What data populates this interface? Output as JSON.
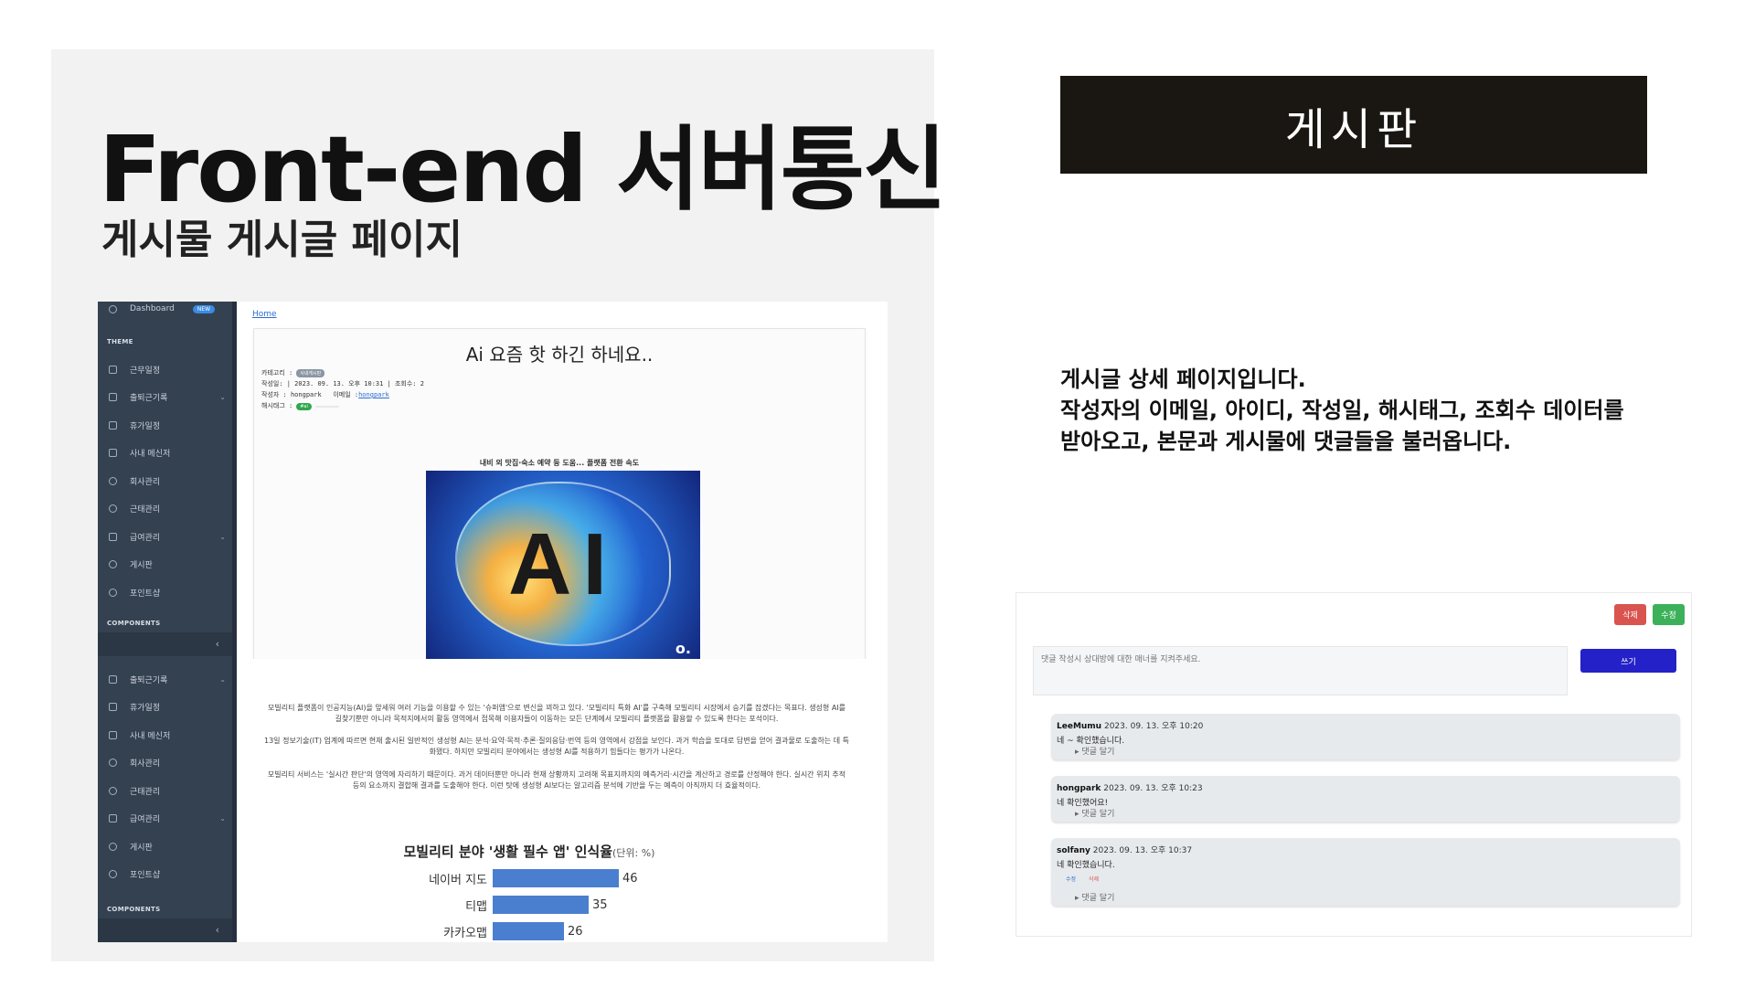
{
  "slide": {
    "title": "Front-end 서버통신",
    "subtitle": "게시물 게시글 페이지",
    "header_box": "게시판",
    "description": [
      "게시글 상세 페이지입니다.",
      "작성자의 이메일, 아이디, 작성일, 해시태그, 조회수 데이터를",
      "받아오고, 본문과 게시물에 댓글들을 불러옵니다."
    ]
  },
  "sidebar": {
    "dashboard": "Dashboard",
    "new_badge": "NEW",
    "theme_section": "THEME",
    "components_section": "COMPONENTS",
    "collapse_glyph": "‹",
    "items_top": [
      {
        "label": "근무일정",
        "icon": "calendar-icon",
        "chevron": false
      },
      {
        "label": "출퇴근기록",
        "icon": "clipboard-icon",
        "chevron": true
      },
      {
        "label": "휴가일정",
        "icon": "columns-icon",
        "chevron": false
      },
      {
        "label": "사내 메신저",
        "icon": "message-icon",
        "chevron": false
      },
      {
        "label": "회사관리",
        "icon": "circle-gear-icon",
        "chevron": false
      },
      {
        "label": "근태관리",
        "icon": "circle-gear-icon",
        "chevron": false
      },
      {
        "label": "급여관리",
        "icon": "money-icon",
        "chevron": true
      },
      {
        "label": "게시판",
        "icon": "circle-gear-icon",
        "chevron": false
      },
      {
        "label": "포인트샵",
        "icon": "circle-gear-icon",
        "chevron": false
      }
    ],
    "items_bottom": [
      {
        "label": "출퇴근기록",
        "icon": "clipboard-icon",
        "chevron": true
      },
      {
        "label": "휴가일정",
        "icon": "columns-icon",
        "chevron": false
      },
      {
        "label": "사내 메신저",
        "icon": "message-icon",
        "chevron": false
      },
      {
        "label": "회사관리",
        "icon": "circle-gear-icon",
        "chevron": false
      },
      {
        "label": "근태관리",
        "icon": "circle-gear-icon",
        "chevron": false
      },
      {
        "label": "급여관리",
        "icon": "money-icon",
        "chevron": true
      },
      {
        "label": "게시판",
        "icon": "circle-gear-icon",
        "chevron": false
      },
      {
        "label": "포인트샵",
        "icon": "circle-gear-icon",
        "chevron": false
      }
    ]
  },
  "post": {
    "breadcrumb": "Home",
    "title": "Ai 요즘 핫 하긴 하네요..",
    "category_label": "카테고리 :",
    "category_value": "사내게시판",
    "date_line": "작성일: | 2023. 09. 13. 오후 10:31 | 조회수: 2",
    "author_label": "작성자 : hongpark",
    "email_label": "이메일 :",
    "email_value": "hongpark",
    "hashtag_label": "해시태그 :",
    "hashtag_value": "#ai",
    "article_caption": "내비 외 맛집·숙소 예약 등 도움... 플랫폼 전환 속도",
    "image_text": "AI",
    "image_logo": "o.",
    "paragraphs": [
      "모빌리티 플랫폼이 인공지능(AI)을 앞세워 여러 기능을 이용할 수 있는 '슈퍼앱'으로 변신을 꾀하고 있다. '모빌리티 특화 AI'를 구축해 모빌리티 시장에서 승기를 잡겠다는 목표다. 생성형 AI를 길찾기뿐만 아니라 목적지에서의 활동 영역에서 접목해 이용자들이 이동하는 모든 단계에서 모빌리티 플랫폼을 활용할 수 있도록 한다는 포석이다.",
      "13일 정보기술(IT) 업계에 따르면 현재 출시된 일반적인 생성형 AI는 분석·요약·목적·추론·질의응답·번역 등의 영역에서 강점을 보인다. 과거 학습을 토대로 답변을 얻어 결과물로 도출하는 데 특화됐다. 하지만 모빌리티 분야에서는 생성형 AI를 적용하기 힘들다는 평가가 나온다.",
      "모빌리티 서비스는 '실시간 판단'의 영역에 자리하기 때문이다. 과거 데이터뿐만 아니라 현재 상황까지 고려해 목표지까지의 예측거리·시간을 계산하고 경로를 산정해야 한다. 실시간 위치 추적 등의 요소까지 결합해 결과를 도출해야 한다. 이런 탓에 생성형 AI보다는 알고리즘 분석에 기반을 두는 예측이 아직까지 더 효율적이다."
    ]
  },
  "chart_data": {
    "type": "bar",
    "title": "모빌리티 분야 '생활 필수 앱' 인식율",
    "unit_note": "(단위: %)",
    "categories": [
      "네이버 지도",
      "티맵",
      "카카오맵"
    ],
    "values": [
      46,
      35,
      26
    ],
    "value_labels": [
      "46",
      "35",
      "26"
    ],
    "xlim": [
      0,
      50
    ]
  },
  "comments": {
    "delete_label": "삭제",
    "edit_label": "수정",
    "placeholder": "댓글 작성시 상대방에 대한 매너를 지켜주세요.",
    "write_label": "쓰기",
    "reply_label": "▸ 댓글 달기",
    "inline_edit": "수정",
    "inline_delete": "삭제",
    "items": [
      {
        "author": "LeeMumu",
        "date": "2023. 09. 13. 오후 10:20",
        "text": "네 ~ 확인했습니다."
      },
      {
        "author": "hongpark",
        "date": "2023. 09. 13. 오후 10:23",
        "text": "네 확인했어요!"
      },
      {
        "author": "solfany",
        "date": "2023. 09. 13. 오후 10:37",
        "text": "네 확인했습니다."
      }
    ]
  },
  "colors": {
    "sidebar_bg": "#344151",
    "header_box_bg": "#1a1712",
    "delete_button": "#d9534f",
    "edit_button": "#3cb15a",
    "write_button": "#2421c9",
    "chart_bar": "#4a7fcf"
  }
}
